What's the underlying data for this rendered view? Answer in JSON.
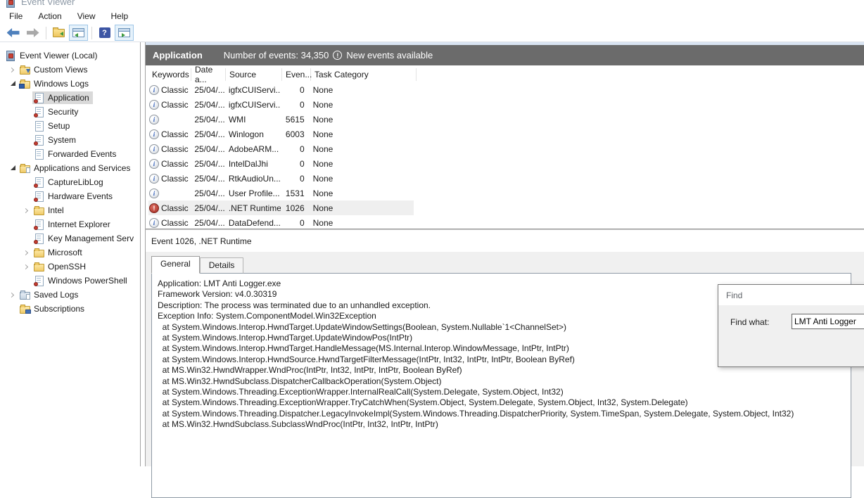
{
  "colors": {
    "panel_header_bg": "#6b6b6b",
    "top_strip": "#d9e4f2",
    "tree_selection": "#d9d9d9",
    "row_selection": "#efefef",
    "border_strong": "#a3a3a3",
    "accent_blue": "#4f81bd",
    "info_blue": "#2d5bb8",
    "error_red": "#b23b30",
    "folder_yellow": "#f0cb69",
    "dialog_bg": "#f0f0f0"
  },
  "window": {
    "title": "Event Viewer"
  },
  "menubar": {
    "items": [
      "File",
      "Action",
      "View",
      "Help"
    ]
  },
  "toolbar": {
    "buttons": [
      {
        "type": "back",
        "name": "back-button",
        "icon": "back-arrow-icon"
      },
      {
        "type": "forward",
        "name": "forward-button",
        "icon": "forward-arrow-icon"
      },
      {
        "type": "separator"
      },
      {
        "type": "folder",
        "name": "open-saved-log-button",
        "icon": "open-folder-icon"
      },
      {
        "type": "tree",
        "name": "toggle-console-tree-button",
        "icon": "console-tree-icon",
        "active": true
      },
      {
        "type": "separator"
      },
      {
        "type": "help",
        "name": "help-button",
        "icon": "help-icon"
      },
      {
        "type": "pane",
        "name": "toggle-action-pane-button",
        "icon": "action-pane-icon",
        "active": true
      }
    ]
  },
  "sidebar": {
    "items": [
      {
        "indent": 0,
        "expander": "none",
        "icon": "event-viewer-icon",
        "label": "Event Viewer (Local)"
      },
      {
        "indent": 1,
        "expander": "collapsed",
        "icon": "folder-filter-icon",
        "label": "Custom Views"
      },
      {
        "indent": 1,
        "expander": "expanded",
        "icon": "folder-monitor-icon",
        "label": "Windows Logs"
      },
      {
        "indent": 2,
        "expander": "none",
        "icon": "log-file-icon",
        "label": "Application",
        "selected": true
      },
      {
        "indent": 2,
        "expander": "none",
        "icon": "log-file-icon",
        "label": "Security"
      },
      {
        "indent": 2,
        "expander": "none",
        "icon": "log-file-plain-icon",
        "label": "Setup"
      },
      {
        "indent": 2,
        "expander": "none",
        "icon": "log-file-icon",
        "label": "System"
      },
      {
        "indent": 2,
        "expander": "none",
        "icon": "log-file-plain-icon",
        "label": "Forwarded Events"
      },
      {
        "indent": 1,
        "expander": "expanded",
        "icon": "folder-page-icon",
        "label": "Applications and Services"
      },
      {
        "indent": 2,
        "expander": "none",
        "icon": "log-file-icon",
        "label": "CaptureLibLog"
      },
      {
        "indent": 2,
        "expander": "none",
        "icon": "log-file-icon",
        "label": "Hardware Events"
      },
      {
        "indent": 2,
        "expander": "collapsed",
        "icon": "folder-icon",
        "label": "Intel"
      },
      {
        "indent": 2,
        "expander": "none",
        "icon": "log-file-icon",
        "label": "Internet Explorer"
      },
      {
        "indent": 2,
        "expander": "none",
        "icon": "log-file-icon",
        "label": "Key Management Serv"
      },
      {
        "indent": 2,
        "expander": "collapsed",
        "icon": "folder-icon",
        "label": "Microsoft"
      },
      {
        "indent": 2,
        "expander": "collapsed",
        "icon": "folder-icon",
        "label": "OpenSSH"
      },
      {
        "indent": 2,
        "expander": "none",
        "icon": "log-file-icon",
        "label": "Windows PowerShell"
      },
      {
        "indent": 1,
        "expander": "collapsed",
        "icon": "saved-logs-icon",
        "label": "Saved Logs"
      },
      {
        "indent": 1,
        "expander": "none",
        "icon": "subscriptions-icon",
        "label": "Subscriptions"
      }
    ]
  },
  "main": {
    "header": {
      "title": "Application",
      "count_label": "Number of events: 34,350",
      "new_events_label": "New events available"
    },
    "table": {
      "columns": [
        "Keywords",
        "Date a...",
        "Source",
        "Even...",
        "Task Category"
      ],
      "rows": [
        {
          "level": "info",
          "keywords": "Classic",
          "date": "25/04/...",
          "source": "igfxCUIServi...",
          "event_id": "0",
          "task": "None"
        },
        {
          "level": "info",
          "keywords": "Classic",
          "date": "25/04/...",
          "source": "igfxCUIServi...",
          "event_id": "0",
          "task": "None"
        },
        {
          "level": "info",
          "keywords": "",
          "date": "25/04/...",
          "source": "WMI",
          "event_id": "5615",
          "task": "None"
        },
        {
          "level": "info",
          "keywords": "Classic",
          "date": "25/04/...",
          "source": "Winlogon",
          "event_id": "6003",
          "task": "None"
        },
        {
          "level": "info",
          "keywords": "Classic",
          "date": "25/04/...",
          "source": "AdobeARM...",
          "event_id": "0",
          "task": "None"
        },
        {
          "level": "info",
          "keywords": "Classic",
          "date": "25/04/...",
          "source": "IntelDalJhi",
          "event_id": "0",
          "task": "None"
        },
        {
          "level": "info",
          "keywords": "Classic",
          "date": "25/04/...",
          "source": "RtkAudioUn...",
          "event_id": "0",
          "task": "None"
        },
        {
          "level": "info",
          "keywords": "",
          "date": "25/04/...",
          "source": "User Profile...",
          "event_id": "1531",
          "task": "None"
        },
        {
          "level": "error",
          "keywords": "Classic",
          "date": "25/04/...",
          "source": ".NET Runtime",
          "event_id": "1026",
          "task": "None",
          "selected": true
        },
        {
          "level": "info",
          "keywords": "Classic",
          "date": "25/04/...",
          "source": "DataDefend...",
          "event_id": "0",
          "task": "None"
        }
      ]
    }
  },
  "preview": {
    "title": "Event 1026, .NET Runtime",
    "tabs": [
      {
        "label": "General",
        "active": true
      },
      {
        "label": "Details",
        "active": false
      }
    ],
    "lines": [
      "Application: LMT Anti Logger.exe",
      "Framework Version: v4.0.30319",
      "Description: The process was terminated due to an unhandled exception.",
      "Exception Info: System.ComponentModel.Win32Exception",
      "  at System.Windows.Interop.HwndTarget.UpdateWindowSettings(Boolean, System.Nullable`1<ChannelSet>)",
      "  at System.Windows.Interop.HwndTarget.UpdateWindowPos(IntPtr)",
      "  at System.Windows.Interop.HwndTarget.HandleMessage(MS.Internal.Interop.WindowMessage, IntPtr, IntPtr)",
      "  at System.Windows.Interop.HwndSource.HwndTargetFilterMessage(IntPtr, Int32, IntPtr, IntPtr, Boolean ByRef)",
      "  at MS.Win32.HwndWrapper.WndProc(IntPtr, Int32, IntPtr, IntPtr, Boolean ByRef)",
      "  at MS.Win32.HwndSubclass.DispatcherCallbackOperation(System.Object)",
      "  at System.Windows.Threading.ExceptionWrapper.InternalRealCall(System.Delegate, System.Object, Int32)",
      "  at System.Windows.Threading.ExceptionWrapper.TryCatchWhen(System.Object, System.Delegate, System.Object, Int32, System.Delegate)",
      "  at System.Windows.Threading.Dispatcher.LegacyInvokeImpl(System.Windows.Threading.DispatcherPriority, System.TimeSpan, System.Delegate, System.Object, Int32)",
      "  at MS.Win32.HwndSubclass.SubclassWndProc(IntPtr, Int32, IntPtr, IntPtr)"
    ]
  },
  "find": {
    "title": "Find",
    "label": "Find what:",
    "value": "LMT Anti Logger"
  }
}
